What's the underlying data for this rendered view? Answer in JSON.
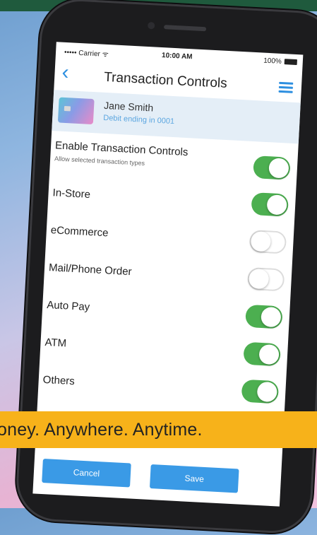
{
  "status": {
    "carrier": "••••• Carrier ᯤ",
    "time": "10:00 AM",
    "battery": "100%"
  },
  "nav": {
    "back_icon": "‹",
    "title": "Transaction Controls"
  },
  "card": {
    "name": "Jane Smith",
    "subtitle": "Debit ending in 0001"
  },
  "enable": {
    "title": "Enable Transaction Controls",
    "subtitle": "Allow selected transaction types",
    "on": true
  },
  "items": [
    {
      "label": "In-Store",
      "on": true
    },
    {
      "label": "eCommerce",
      "on": false
    },
    {
      "label": "Mail/Phone Order",
      "on": false
    },
    {
      "label": "Auto Pay",
      "on": true
    },
    {
      "label": "ATM",
      "on": true
    },
    {
      "label": "Others",
      "on": true
    }
  ],
  "buttons": {
    "cancel": "Cancel",
    "save": "Save"
  },
  "banner": {
    "text": "oney. Anywhere. Anytime."
  },
  "colors": {
    "accent": "#2d8fe0",
    "toggle_on": "#4caf50",
    "banner": "#f7b21a",
    "topbar": "#1f5a3d"
  }
}
